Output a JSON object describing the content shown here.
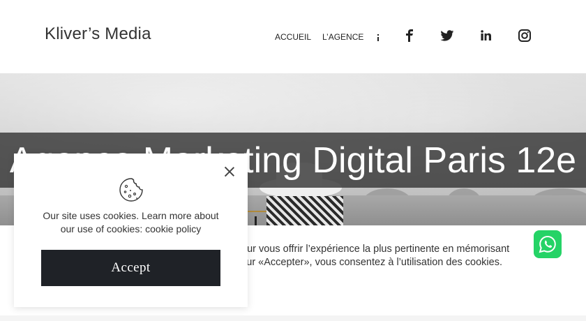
{
  "header": {
    "logo": "Kliver’s Media",
    "nav": [
      {
        "label": "ACCUEIL"
      },
      {
        "label": "L’AGENCE"
      }
    ],
    "social": [
      "facebook-icon",
      "twitter-icon",
      "linkedin-icon",
      "instagram-icon"
    ]
  },
  "hero": {
    "title": "Agence Marketing Digital Paris 12e"
  },
  "notice": {
    "line1": "our vous offrir l’expérience la plus pertinente en mémorisant",
    "line2": "sur «Accepter», vous consentez à l’utilisation des cookies."
  },
  "cookie": {
    "text": "Our site uses cookies. Learn more about our use of cookies:",
    "link": "cookie policy",
    "accept": "Accept"
  },
  "colors": {
    "accept_bg": "#1f2227",
    "whatsapp": "#25d366",
    "title_band": "#373737"
  }
}
